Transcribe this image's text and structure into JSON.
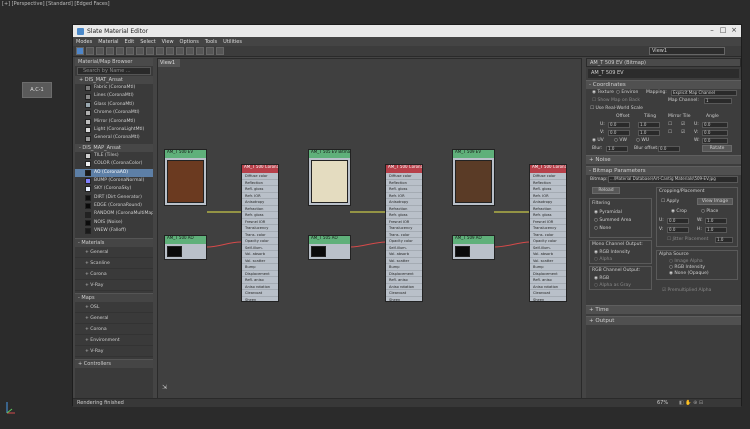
{
  "viewport": {
    "label": "[+] [Perspective] [Standard] [Edged Faces]",
    "button": "A.C-1"
  },
  "window": {
    "title": "Slate Material Editor",
    "menus": [
      "Modes",
      "Material",
      "Edit",
      "Select",
      "View",
      "Options",
      "Tools",
      "Utilities"
    ],
    "view_select": "View1"
  },
  "browser": {
    "title": "Material/Map Browser",
    "search_placeholder": "Search by Name ...",
    "group1": "+ DIS_MAT_Ansat",
    "group1_items": [
      {
        "label": "Fabric (CoronaMtl)",
        "color": "#7a7a7a"
      },
      {
        "label": "Lines (CoronaMtl)",
        "color": "#8a8a8a"
      },
      {
        "label": "Glass (CoronaMtl)",
        "color": "#9aa8b0"
      },
      {
        "label": "Chrome (CoronaMtl)",
        "color": "#b0b0b0"
      },
      {
        "label": "Mirror (CoronaMtl)",
        "color": "#c0c0c0"
      },
      {
        "label": "Light (CoronaLightMtl)",
        "color": "#dcdcdc"
      },
      {
        "label": "General (CoronaMtl)",
        "color": "#9a9a9a"
      }
    ],
    "group2": "- DIS_MAP_Ansat",
    "group2_items": [
      {
        "label": "TILE (Tiles)",
        "color": "#cfcfcf"
      },
      {
        "label": "COLOR (CoronaColor)",
        "color": "#f0f0f0"
      },
      {
        "label": "AO (CoronaAO)",
        "color": "#1a1a1a"
      },
      {
        "label": "BUMP (CoronaNormal)",
        "color": "#8080ff"
      },
      {
        "label": "SKY (CoronaSky)",
        "color": "#e8f0ff"
      },
      {
        "label": "DIRT (Dirt Generator)",
        "color": "#101010"
      },
      {
        "label": "EDGE (CoronaRound)",
        "color": "#0a0a0a"
      },
      {
        "label": "RANDOM (CoronaMultiMap)",
        "color": "#222222"
      },
      {
        "label": "NOIS (Noise)",
        "color": "#0c0c0c"
      },
      {
        "label": "VNEW (Falloff)",
        "color": "#1a1a1a"
      }
    ],
    "section_materials": "- Materials",
    "materials": [
      "+ General",
      "+ Scanline",
      "+ Corona",
      "+ V-Ray"
    ],
    "section_maps": "- Maps",
    "maps": [
      "+ OSL",
      "+ General",
      "+ Corona",
      "+ Environment",
      "+ V-Ray"
    ],
    "section_controllers": "+ Controllers"
  },
  "canvas": {
    "view_tab": "View1"
  },
  "nodes": {
    "bitmap1_title": "AM_T 500 EV",
    "bitmap2_title": "AM_T 505 EV Bitmap",
    "bitmap3_title": "AM_T 509 EV",
    "ao_title": "AM_T 500 AO",
    "ao2_title": "AM_T 505 AO",
    "ao3_title": "AM_T 509 AO",
    "mtl_title": "AM_T 500 Corona",
    "slots": [
      "Diffuse color",
      "Reflection",
      "Refl. gloss",
      "Refr. IOR",
      "Anisotropy",
      "Refraction",
      "Refr. gloss",
      "Fresnel IOR",
      "Translucency",
      "Trans. color",
      "Opacity color",
      "Self-illum.",
      "Vol. absorb",
      "Vol. scatter",
      "Bump",
      "Displacement",
      "Refl. aniso",
      "Aniso rotation",
      "Clearcoat",
      "Sheen",
      "Sheen color",
      "Subsurface scatter"
    ]
  },
  "right_panel": {
    "header": "AM_T 509 EV (Bitmap)",
    "map_name": "AM_T 509 EV",
    "coordinates": "- Coordinates",
    "texture": "Texture",
    "environ": "Environ",
    "mapping_label": "Mapping:",
    "mapping_value": "Explicit Map Channel",
    "show_map": "Show Map on Back",
    "map_channel_label": "Map Channel:",
    "map_channel": "1",
    "real_world": "Use Real-World Scale",
    "offset": "Offset",
    "tiling": "Tiling",
    "mirror_tile": "Mirror Tile",
    "angle": "Angle",
    "u": "U:",
    "v": "V:",
    "w": "W:",
    "u_offset": "0.0",
    "v_offset": "0.0",
    "u_tiling": "1.0",
    "v_tiling": "1.0",
    "u_angle": "0.0",
    "v_angle": "0.0",
    "w_angle": "0.0",
    "uv": "UV",
    "vw": "VW",
    "wu": "WU",
    "blur_label": "Blur:",
    "blur": "1.0",
    "blur_offset_label": "Blur offset:",
    "blur_offset": "0.0",
    "rotate": "Rotate",
    "noise": "+ Noise",
    "bitmap_params": "- Bitmap Parameters",
    "bitmap_label": "Bitmap:",
    "bitmap_path": "...\\Material Database\\Art-Cantig Materials\\509-EV.jpg",
    "reload": "Reload",
    "cropping": "Cropping/Placement",
    "apply": "Apply",
    "view_image": "View Image",
    "crop": "Crop",
    "place": "Place",
    "filtering": "Filtering",
    "pyramidal": "Pyramidal",
    "summed": "Summed Area",
    "none": "None",
    "mono": "Mono Channel Output:",
    "rgb_intensity": "RGB Intensity",
    "alpha": "Alpha",
    "rgb_out": "RGB Channel Output:",
    "rgb": "RGB",
    "alpha_gray": "Alpha as Gray",
    "cu": "U:",
    "cv": "V:",
    "cw": "W:",
    "ch": "H:",
    "cu_val": "0.0",
    "cv_val": "0.0",
    "cw_val": "1.0",
    "ch_val": "1.0",
    "jitter": "Jitter Placement",
    "jitter_val": "1.0",
    "alpha_source": "Alpha Source",
    "image_alpha": "Image Alpha",
    "rgb_intensity2": "RGB Intensity",
    "none_opaque": "None (Opaque)",
    "premult": "Premultiplied Alpha",
    "time": "+ Time",
    "output": "+ Output"
  },
  "status": {
    "text": "Rendering finished",
    "zoom": "67%"
  }
}
